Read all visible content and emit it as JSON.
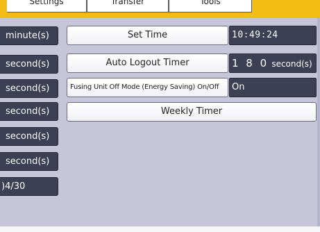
{
  "tabs": [
    {
      "label": "Settings"
    },
    {
      "label": "Transfer"
    },
    {
      "label": "Tools"
    }
  ],
  "left_column": [
    {
      "label": "minute(s)"
    },
    {
      "label": "second(s)"
    },
    {
      "label": "second(s)"
    },
    {
      "label": "second(s)"
    },
    {
      "label": "second(s)"
    },
    {
      "label": "second(s)"
    },
    {
      "label": ")4/30"
    }
  ],
  "settings": {
    "set_time": {
      "label": "Set Time",
      "value": "10:49:24"
    },
    "auto_logout": {
      "label": "Auto Logout Timer",
      "value": "1 8 0",
      "unit": "second(s)"
    },
    "fusing_unit": {
      "label": "Fusing Unit Off Mode (Energy Saving) On/Off",
      "value": "On"
    },
    "weekly_timer": {
      "label": "Weekly Timer"
    }
  },
  "colors": {
    "tab_bar": "#f3bc15",
    "panel_background": "#c7c5da",
    "dark_button": "#3d4055",
    "light_button": "#ffffff"
  }
}
